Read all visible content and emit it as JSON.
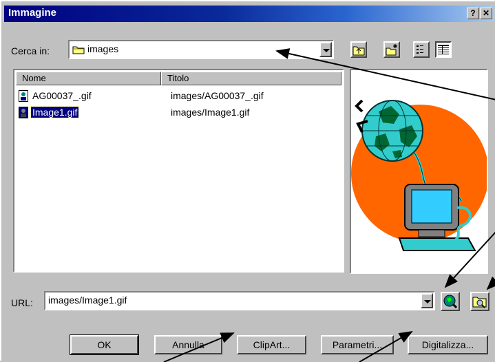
{
  "window": {
    "title": "Immagine",
    "help_button": "?",
    "close_button": "✕"
  },
  "look_in": {
    "label": "Cerca in:",
    "value": "images"
  },
  "list": {
    "columns": [
      "Nome",
      "Titolo"
    ],
    "files": [
      {
        "name": "AG00037_.gif",
        "title": "images/AG00037_.gif",
        "selected": false
      },
      {
        "name": "Image1.gif",
        "title": "images/Image1.gif",
        "selected": true
      }
    ]
  },
  "url": {
    "label": "URL:",
    "value": "images/Image1.gif"
  },
  "buttons": {
    "ok": "OK",
    "cancel": "Annulla",
    "clipart": "ClipArt...",
    "params": "Parametri...",
    "scan": "Digitalizza..."
  }
}
